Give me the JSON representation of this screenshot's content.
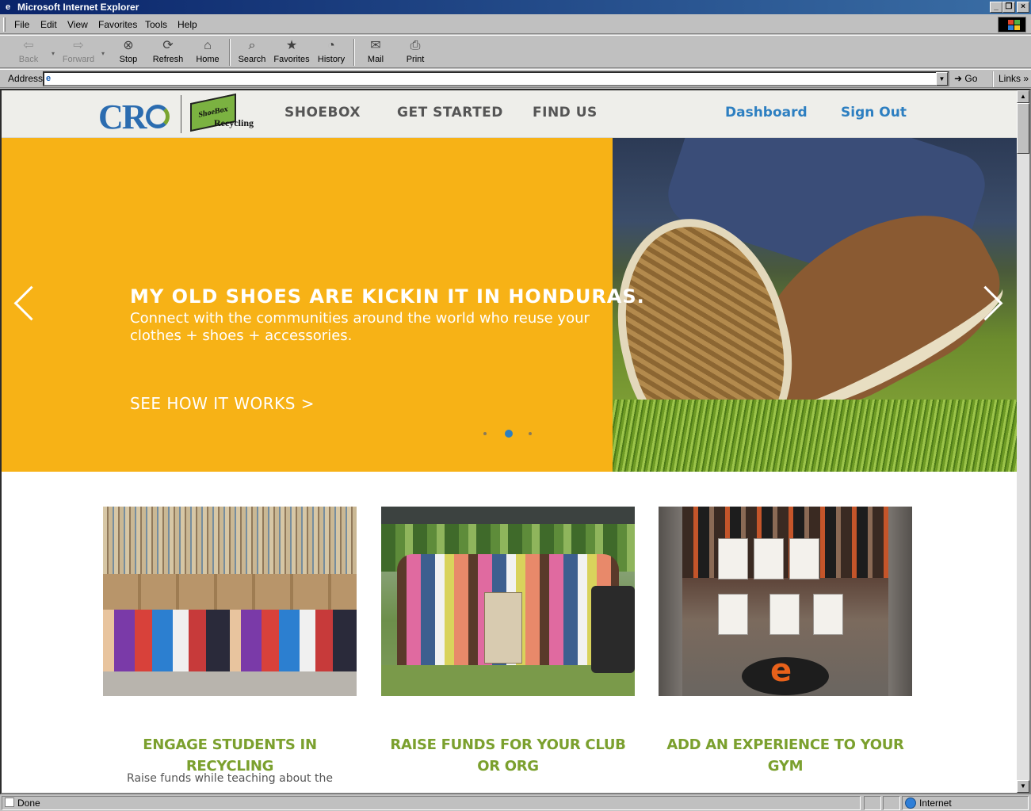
{
  "window": {
    "title": "Microsoft Internet Explorer",
    "controls": [
      "_",
      "❐",
      "×"
    ]
  },
  "menu": [
    "File",
    "Edit",
    "View",
    "Favorites",
    "Tools",
    "Help"
  ],
  "toolbar": {
    "back": "Back",
    "forward": "Forward",
    "stop": "Stop",
    "refresh": "Refresh",
    "home": "Home",
    "search": "Search",
    "favorites": "Favorites",
    "history": "History",
    "mail": "Mail",
    "print": "Print"
  },
  "address": {
    "label": "Address",
    "value": "",
    "go": "Go",
    "links": "Links"
  },
  "site": {
    "logo_text": "CR",
    "logo_sub": "ShoeBox",
    "logo_sub2": "Recycling",
    "nav": [
      "SHOEBOX",
      "GET STARTED",
      "FIND US"
    ],
    "dashboard": "Dashboard",
    "sign_out": "Sign Out",
    "accent_color": "#f7b216",
    "link_color": "#2d7fc1",
    "title_color": "#7ba02e"
  },
  "hero": {
    "headline": "MY OLD SHOES ARE KICKIN IT IN HONDURAS.",
    "subtext": "Connect with the communities around the world who reuse your clothes + shoes + accessories.",
    "cta": "SEE HOW IT WORKS >",
    "slide_count": 3,
    "active_slide": 2
  },
  "cards": [
    {
      "title": "ENGAGE STUDENTS IN RECYCLING",
      "text": "Raise funds while teaching about the"
    },
    {
      "title": "RAISE FUNDS FOR YOUR CLUB OR ORG",
      "text": ""
    },
    {
      "title": "ADD AN EXPERIENCE TO YOUR GYM",
      "text": ""
    }
  ],
  "status": {
    "text": "Done",
    "zone": "Internet"
  }
}
